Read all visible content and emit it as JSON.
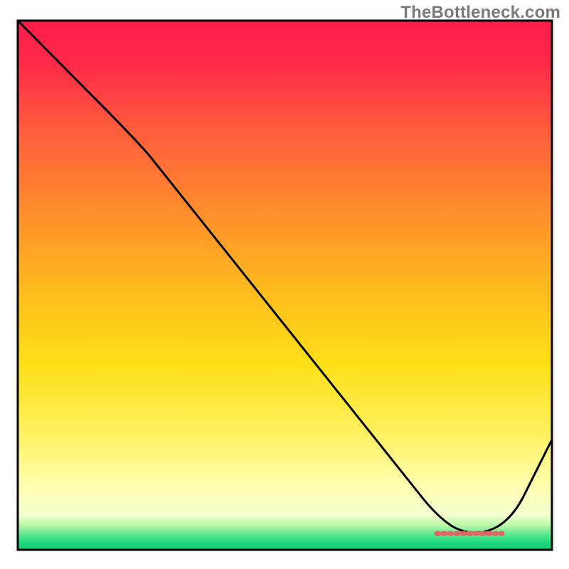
{
  "watermark": "TheBottleneck.com",
  "chart_data": {
    "type": "line",
    "title": "",
    "xlabel": "",
    "ylabel": "",
    "xlim": [
      0,
      100
    ],
    "ylim": [
      0,
      100
    ],
    "grid": false,
    "legend": false,
    "series": [
      {
        "name": "curve",
        "x": [
          0,
          12,
          24,
          40,
          55,
          70,
          78,
          83,
          88,
          92,
          100
        ],
        "values": [
          100,
          87,
          74,
          52,
          33,
          14,
          5,
          1,
          1,
          6,
          17
        ]
      }
    ],
    "annotations": {
      "valley_range_x": [
        78,
        88
      ],
      "valley_value": 1
    },
    "background_gradient_stops": [
      {
        "pos": 0.0,
        "color": "#ff1a4b"
      },
      {
        "pos": 0.5,
        "color": "#ffb81f"
      },
      {
        "pos": 0.78,
        "color": "#fff060"
      },
      {
        "pos": 0.955,
        "color": "#b8f7a8"
      },
      {
        "pos": 1.0,
        "color": "#12cf74"
      }
    ]
  }
}
